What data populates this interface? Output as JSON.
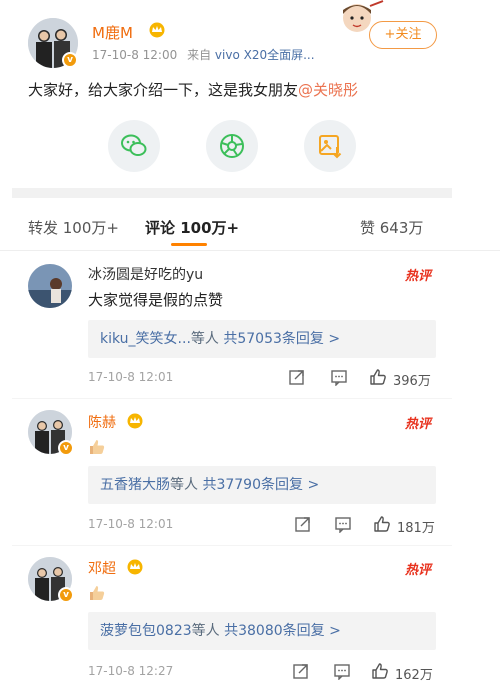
{
  "post": {
    "author": "M鹿M",
    "time": "17-10-8 12:00",
    "source_prefix": "来自",
    "source_device": "vivo X20全面屏...",
    "follow_label": "+关注",
    "text_main": "大家好，给大家介绍一下，这是我女朋友",
    "mention": "@关晓彤"
  },
  "tabs": {
    "repost": "转发 100万+",
    "comments": "评论 100万+",
    "likes": "赞 643万"
  },
  "comments": [
    {
      "user": "冰汤圆是好吃的yu",
      "text": "大家觉得是假的点赞",
      "hot": "热评",
      "reply_users": "kiku_笑笑女...",
      "reply_suffix": "等人",
      "reply_count": "共57053条回复 >",
      "time": "17-10-8 12:01",
      "likes": "396万"
    },
    {
      "user": "陈赫",
      "text": "",
      "hot": "热评",
      "reply_users": "五香猪大肠",
      "reply_suffix": "等人",
      "reply_count": "共37790条回复 >",
      "time": "17-10-8 12:01",
      "likes": "181万"
    },
    {
      "user": "邓超",
      "text": "",
      "hot": "热评",
      "reply_users": "菠萝包包0823",
      "reply_suffix": "等人",
      "reply_count": "共38080条回复 >",
      "time": "17-10-8 12:27",
      "likes": "162万"
    }
  ],
  "colors": {
    "accent_orange": "#ff8200",
    "link_blue": "#4a6fa5",
    "mention": "#eb7350"
  }
}
